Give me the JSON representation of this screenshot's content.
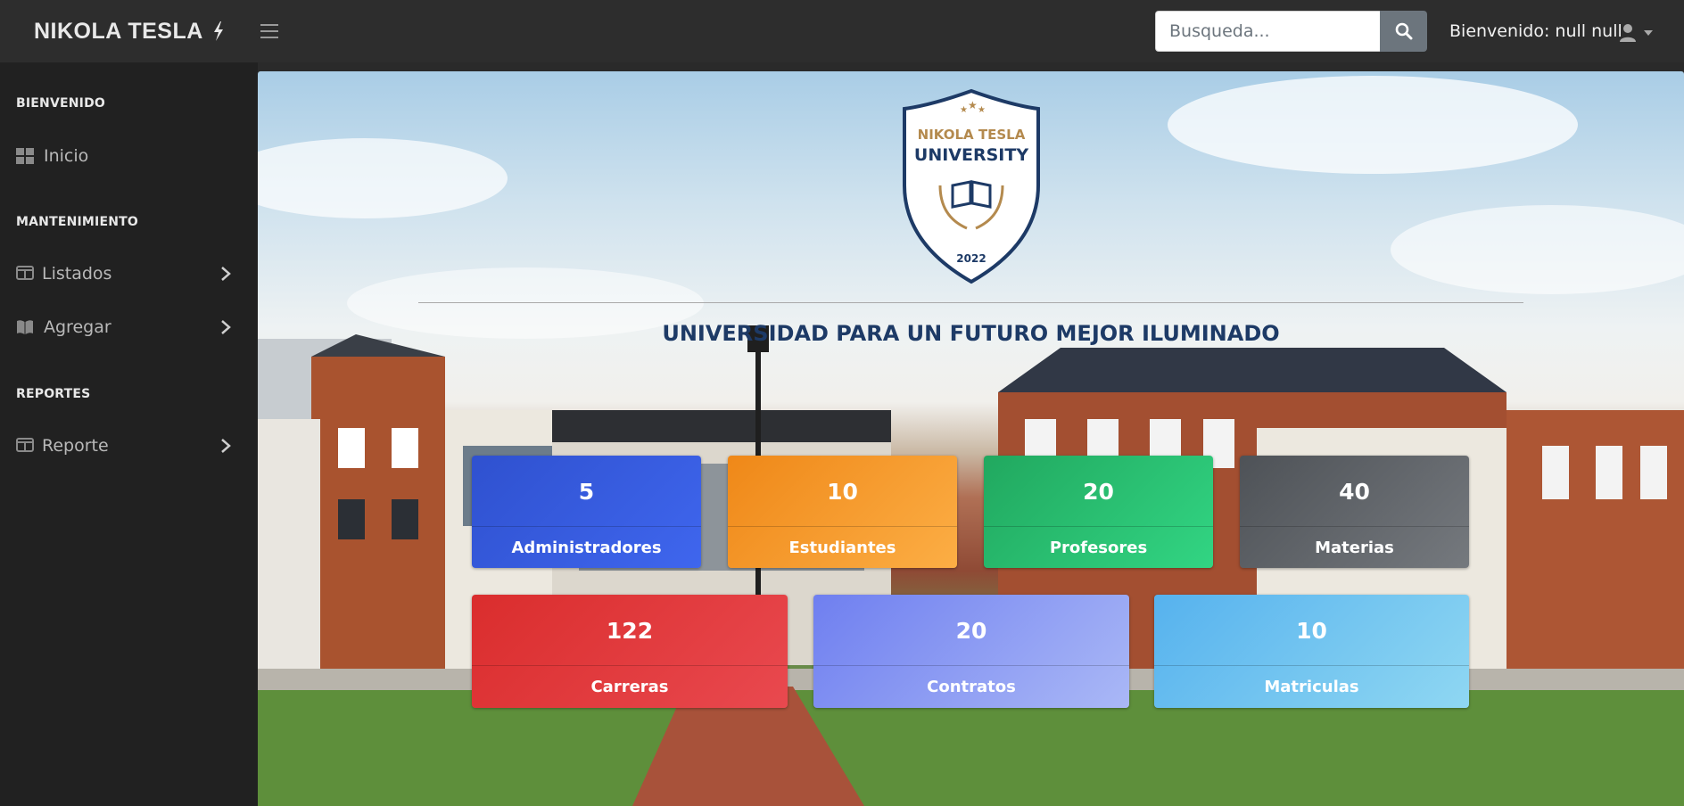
{
  "navbar": {
    "brand": "NIKOLA TESLA",
    "brand_icon": "bolt-icon",
    "search_placeholder": "Busqueda...",
    "welcome_text": "Bienvenido: null null"
  },
  "sidebar": {
    "sections": [
      {
        "heading": "BIENVENIDO",
        "items": [
          {
            "label": "Inicio",
            "icon": "dashboard-icon"
          }
        ]
      },
      {
        "heading": "MANTENIMIENTO",
        "items": [
          {
            "label": "Listados",
            "icon": "columns-icon"
          },
          {
            "label": "Agregar",
            "icon": "book-open-icon"
          }
        ]
      },
      {
        "heading": "REPORTES",
        "items": [
          {
            "label": "Reporte",
            "icon": "columns-icon"
          }
        ]
      }
    ]
  },
  "hero": {
    "logo": {
      "line1": "NIKOLA TESLA",
      "line2": "UNIVERSITY",
      "year": "2022"
    },
    "tagline": "UNIVERSIDAD PARA UN FUTURO MEJOR ILUMINADO"
  },
  "stats": [
    {
      "value": "5",
      "label": "Administradores",
      "color": "#3b5fe0"
    },
    {
      "value": "10",
      "label": "Estudiantes",
      "color": "#f39a25"
    },
    {
      "value": "20",
      "label": "Profesores",
      "color": "#2bbf72"
    },
    {
      "value": "40",
      "label": "Materias",
      "color": "#5a5e64"
    },
    {
      "value": "122",
      "label": "Carreras",
      "color": "#e03c3c"
    },
    {
      "value": "20",
      "label": "Contratos",
      "color": "#8a97f0"
    },
    {
      "value": "10",
      "label": "Matriculas",
      "color": "#6cc0ee"
    }
  ]
}
